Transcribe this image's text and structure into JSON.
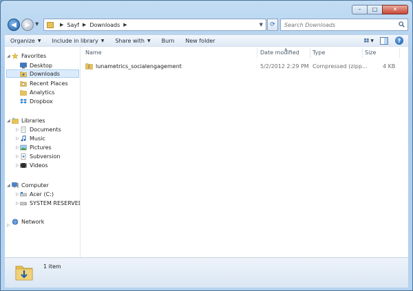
{
  "window": {
    "caption": {
      "minimize_label": "–",
      "maximize_label": "□",
      "close_label": "✕"
    }
  },
  "address_bar": {
    "breadcrumb": [
      "Sayf",
      "Downloads"
    ],
    "search_placeholder": "Search Downloads"
  },
  "toolbar": {
    "commands": [
      {
        "label": "Organize",
        "has_dropdown": true
      },
      {
        "label": "Include in library",
        "has_dropdown": true
      },
      {
        "label": "Share with",
        "has_dropdown": true
      },
      {
        "label": "Burn",
        "has_dropdown": false
      },
      {
        "label": "New folder",
        "has_dropdown": false
      }
    ],
    "help_label": "?"
  },
  "nav_pane": {
    "favorites": {
      "label": "Favorites",
      "items": [
        "Desktop",
        "Downloads",
        "Recent Places",
        "Analytics",
        "Dropbox"
      ],
      "selected": "Downloads"
    },
    "libraries": {
      "label": "Libraries",
      "items": [
        "Documents",
        "Music",
        "Pictures",
        "Subversion",
        "Videos"
      ]
    },
    "computer": {
      "label": "Computer",
      "items": [
        "Acer (C:)",
        "SYSTEM RESERVED ("
      ]
    },
    "network": {
      "label": "Network"
    }
  },
  "file_list": {
    "columns": {
      "name": "Name",
      "date": "Date modified",
      "type": "Type",
      "size": "Size"
    },
    "rows": [
      {
        "name": "lunametrics_socialengagement",
        "date": "5/2/2012 2:29 PM",
        "type": "Compressed (zipp...",
        "size": "4 KB"
      }
    ]
  },
  "details_pane": {
    "item_count": "1 item"
  },
  "colors": {
    "accent": "#1f5fa6",
    "selection": "#dcebfc",
    "folder": "#e8c35a"
  }
}
